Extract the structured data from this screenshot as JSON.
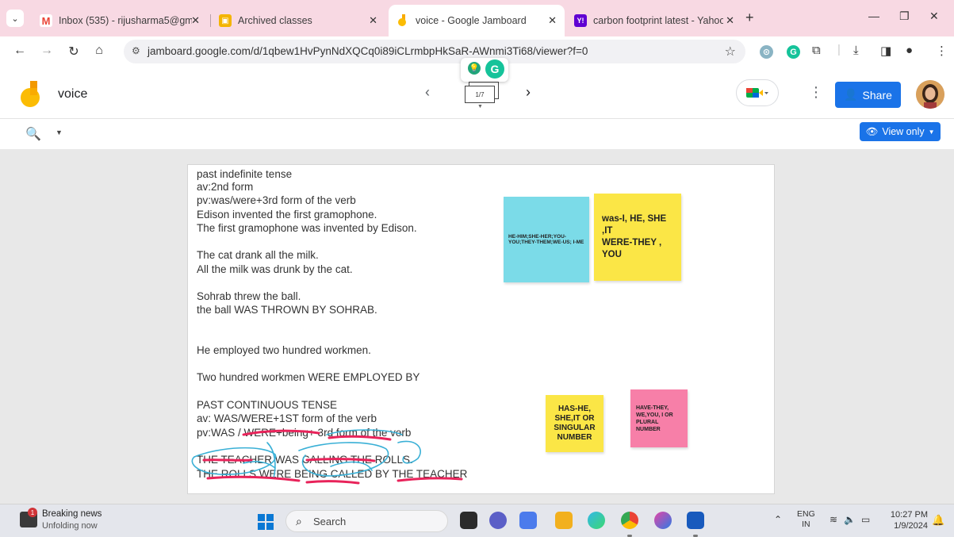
{
  "browser": {
    "tabs": [
      {
        "title": "Inbox (535) - rijusharma5@gma",
        "favicon": "gmail-icon",
        "color": "#ea4335",
        "glyph": "M"
      },
      {
        "title": "Archived classes",
        "favicon": "classroom-icon",
        "color": "#f4b400",
        "glyph": "▣"
      },
      {
        "title": "voice - Google Jamboard",
        "favicon": "jamboard-icon",
        "color": "#f9ab00",
        "glyph": "J"
      },
      {
        "title": "carbon footprint latest - Yahoo",
        "favicon": "yahoo-icon",
        "color": "#6001d2",
        "glyph": "Y!"
      }
    ],
    "url": "jamboard.google.com/d/1qbew1HvPynNdXQCq0i89iCLrmbpHkSaR-AWnmi3Ti68/viewer?f=0"
  },
  "app": {
    "doc_title": "voice",
    "frame_indicator": "1/7",
    "share_label": "Share",
    "view_only_label": "View only"
  },
  "board": {
    "lines": [
      "past indefinite tense",
      "av:2nd form",
      "pv:was/were+3rd form of the verb",
      "Edison invented the first gramophone.",
      "The first gramophone was invented by Edison.",
      "The cat drank all the milk.",
      "All the milk  was drunk by the cat.",
      "Sohrab threw the ball.",
      " the ball WAS THROWN BY SOHRAB.",
      "He employed two hundred workmen.",
      "Two hundred workmen WERE EMPLOYED BY",
      "PAST CONTINUOUS TENSE",
      "av: WAS/WERE+1ST form of the verb",
      "pv:WAS / WERE+being+ 3rd form of the verb",
      "THE TEACHER WAS CALLING THE ROLLS.",
      "THE ROLLS WERE BEING CALLED BY THE TEACHER"
    ],
    "stickies": [
      {
        "text": "HE-HIM;SHE-HER;YOU-YOU;THEY-THEM;WE-US; I-ME",
        "color": "#7bdbe8"
      },
      {
        "text": "was-I, HE, SHE ,IT\nWERE-THEY , YOU",
        "color": "#fbe646"
      },
      {
        "text": "HAS-HE, SHE,IT OR SINGULAR NUMBER",
        "color": "#fbe646"
      },
      {
        "text": "HAVE-THEY, WE,YOU, I OR PLURAL NUMBER",
        "color": "#f77fa8"
      }
    ]
  },
  "taskbar": {
    "news_title": "Breaking news",
    "news_sub": "Unfolding now",
    "news_badge": "1",
    "search_label": "Search",
    "lang_top": "ENG",
    "lang_bottom": "IN",
    "time": "10:27 PM",
    "date": "1/9/2024"
  },
  "colors": {
    "tabstrip": "#f8d9e3",
    "accent": "#1a73e8",
    "ink_blue": "#3ab0d6",
    "ink_red": "#e8235a"
  }
}
